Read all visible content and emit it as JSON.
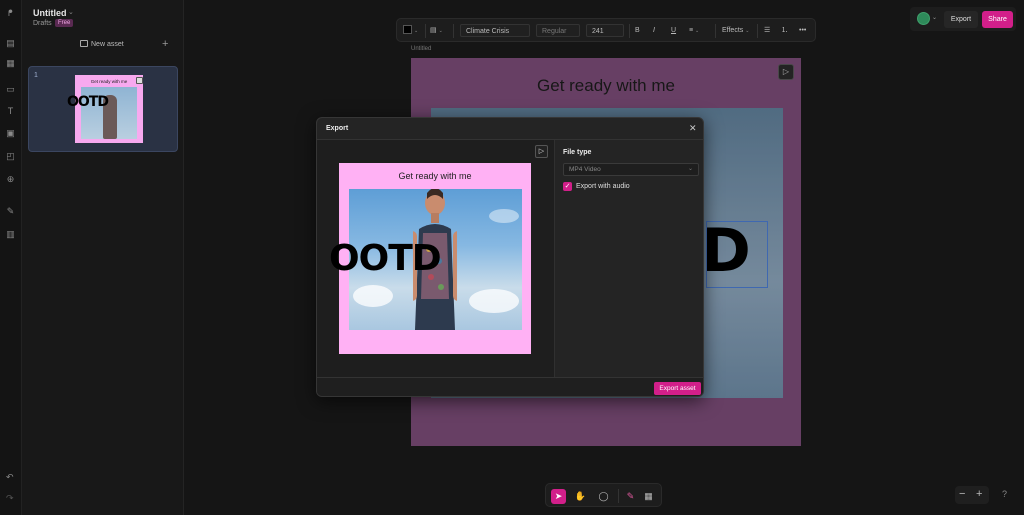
{
  "app": {
    "title": "Untitled",
    "subtitle": "Drafts",
    "plan_badge": "Free"
  },
  "sidebar": {
    "new_asset_label": "New asset",
    "add_icon": "plus-icon",
    "pages": [
      {
        "number": "1",
        "thumb_title": "Get ready with me",
        "thumb_text": "OOTD"
      }
    ]
  },
  "toolbar": {
    "font_family": "Climate Crisis",
    "font_weight": "Regular",
    "font_size": "241",
    "effects_label": "Effects",
    "more_label": "•••"
  },
  "topbar": {
    "export_label": "Export",
    "share_label": "Share"
  },
  "canvas": {
    "artboard_label": "Untitled",
    "title": "Get ready with me",
    "big_text": "D"
  },
  "export_dialog": {
    "title": "Export",
    "close_label": "✕",
    "preview_title": "Get ready with me",
    "preview_text": "OOTD",
    "file_type_label": "File type",
    "file_type_value": "MP4 Video",
    "export_with_audio_label": "Export with audio",
    "export_with_audio_checked": true,
    "export_button_label": "Export asset"
  },
  "colors": {
    "accent": "#d21f8a",
    "artboard_pink": "#ffb1f4"
  },
  "bottom_tools": [
    "pointer-icon",
    "hand-icon",
    "comment-icon",
    "pen-icon",
    "layout-icon"
  ],
  "zoom": {
    "minus": "−",
    "plus": "+"
  },
  "help_label": "?"
}
